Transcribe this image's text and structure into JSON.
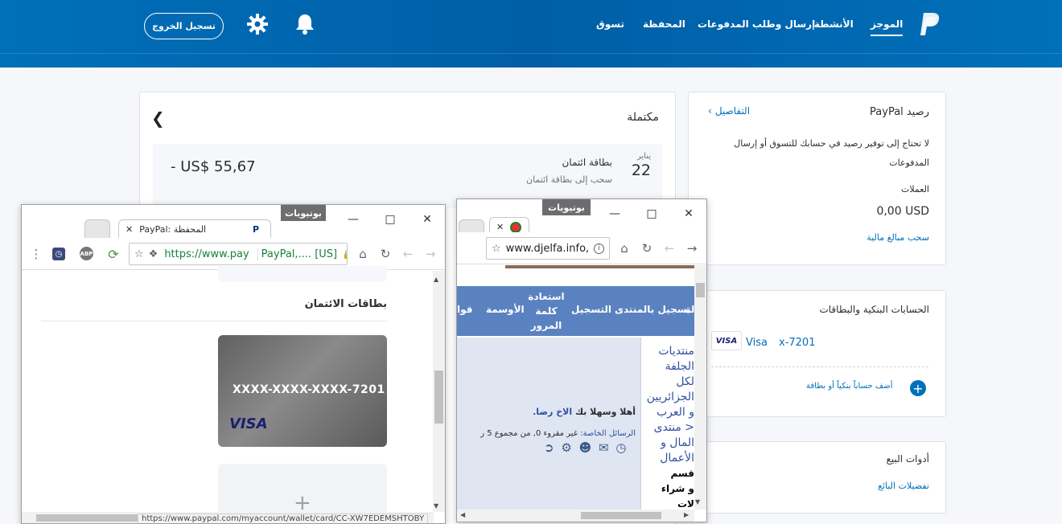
{
  "header": {
    "nav": {
      "summary": "الموجز",
      "activity": "الأنشطة",
      "send_request": "إرسال وطلب المدفوعات",
      "wallet": "المحفظة",
      "shop": "تسوق"
    },
    "logout_label": "تسجيل الخروج",
    "brand_color": "#0070ba"
  },
  "transaction": {
    "status": "مكتملة",
    "month": "يناير",
    "day": "22",
    "title": "بطاقة ائتمان",
    "subtitle": "سحب إلى بطاقة ائتمان",
    "amount": "- US$ 55,67"
  },
  "balance_card": {
    "title": "رصيد PayPal",
    "details_link": "التفاصيل",
    "description": "لا تحتاج إلى توفير رصيد في حسابك للتسوق أو إرسال المدفوعات",
    "currencies_label": "العملات",
    "balance": "0,00 USD",
    "withdraw_link": "سحب مبالغ مالية"
  },
  "banks_card": {
    "title": "الحسابات البنكية والبطاقات",
    "card_brand": "VISA",
    "card_name": "Visa",
    "card_number": "x-7201",
    "add_link": "أضف حساباً بنكياً أو بطاقة"
  },
  "sales_card": {
    "title": "أدوات البيع",
    "prefs_link": "تفضيلات البائع"
  },
  "win_left": {
    "profile_name": "بوتيويات",
    "tab_title": "PayPal: المحفظة",
    "url": "https://www.pay",
    "site_badge": "PayPal,.... [US]",
    "section_title": "بطاقات الائتمان",
    "card_number": "XXXX-XXXX-XXXX-7201",
    "card_brand": "VISA",
    "add_symbol": "+",
    "status_url": "https://www.paypal.com/myaccount/wallet/card/CC-XW7EDEMSHTOBY",
    "ext_abp": "ABP"
  },
  "win_right": {
    "profile_name": "بوتيويات",
    "url": "www.djelfa.info,",
    "nav_items": [
      "التسجيل بالمنتدى",
      "التسجيل",
      "استعادة كلمة المرور",
      "الأوسمة",
      "قوا"
    ],
    "nav_partial_left": "ة",
    "welcome_prefix": "أهلا وسهلا بك",
    "welcome_name": "الاخ رضا.",
    "pm_label": "الرسائل الخاصة:",
    "pm_text": "غير مقروء 0, من مجموع 5 ر",
    "side_lines": [
      "منتديات",
      "الجلفة",
      "لكل",
      "الجزائريين",
      "و العرب",
      "< منتدى",
      "المال و",
      "الأعمال",
      "قسم",
      "و شراء",
      "لات"
    ]
  }
}
